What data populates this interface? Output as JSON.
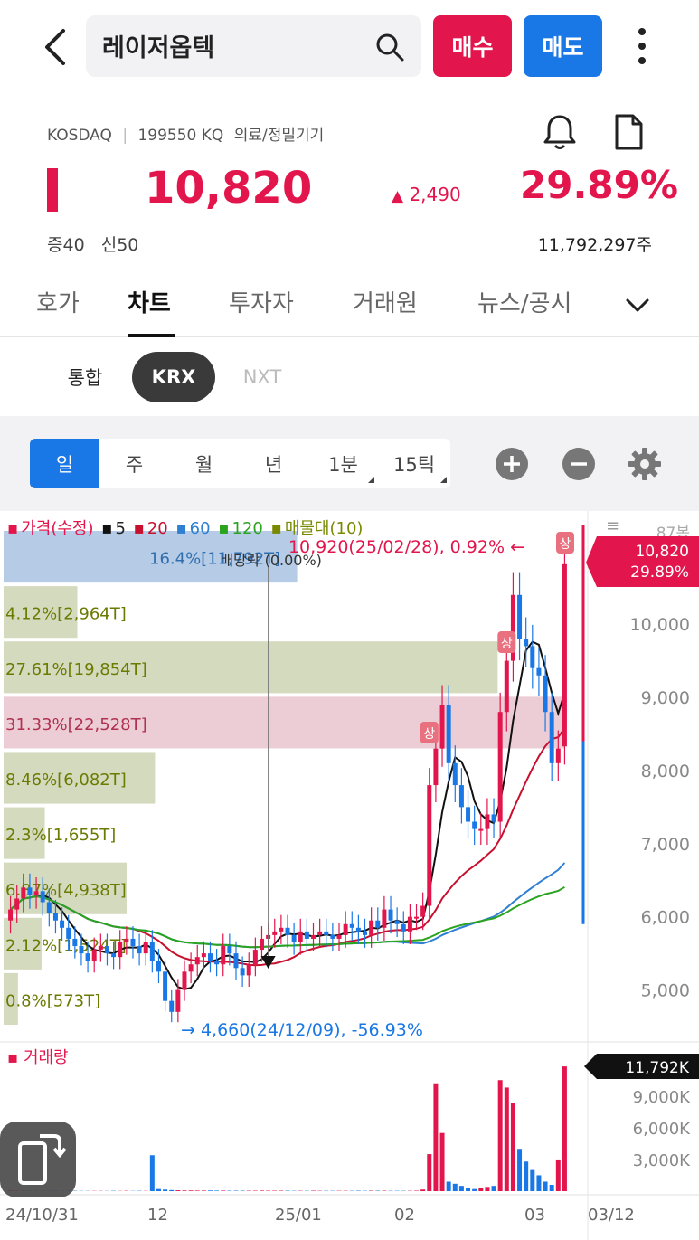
{
  "header": {
    "stock_name": "레이저옵텍",
    "buy_label": "매수",
    "sell_label": "매도"
  },
  "info": {
    "market": "KOSDAQ",
    "separator": "|",
    "code": "199550 KQ",
    "sector": "의료/정밀기기",
    "price": "10,820",
    "change": "2,490",
    "change_rate": "29.89%",
    "margin_rate": "증40",
    "credit_rate": "신50",
    "volume": "11,792,297주"
  },
  "tabs": [
    "호가",
    "차트",
    "투자자",
    "거래원",
    "뉴스/공시"
  ],
  "active_tab": "차트",
  "market_tabs": {
    "all": "통합",
    "krx": "KRX",
    "nxt": "NXT"
  },
  "periods": [
    "일",
    "주",
    "월",
    "년",
    "1분",
    "15틱"
  ],
  "legend": {
    "price": "가격(수정)",
    "ma5": "5",
    "ma20": "20",
    "ma60": "60",
    "ma120": "120",
    "volume_profile": "매물대(10)",
    "volume": "거래량"
  },
  "colors": {
    "up": "#e2164c",
    "down": "#1a78e6",
    "ma5": "#111111",
    "ma20": "#c8102e",
    "ma60": "#2f7fd3",
    "ma120": "#2aa31e",
    "profile": "#7a8a00"
  },
  "chart_data": {
    "type": "candlestick",
    "x_tick_labels": [
      "24/10/31",
      "12",
      "25/01",
      "02",
      "03",
      "03/12"
    ],
    "y_tick_labels": [
      "5,000",
      "6,000",
      "7,000",
      "8,000",
      "9,000",
      "10,000"
    ],
    "y_top_label": "87봉",
    "ylim": [
      4500,
      11300
    ],
    "current_price_label": "10,820",
    "current_rate_label": "29.89%",
    "max_annotation": "10,920(25/02/28), 0.92% ←",
    "min_annotation": "→ 4,660(24/12/09), -56.93%",
    "dividend_annotation": "배당락 (0.00%)",
    "limit_up_badge": "상",
    "volume_profile": [
      {
        "label": "16.4%[11,792T]",
        "pct": 16.4
      },
      {
        "label": "4.12%[2,964T]",
        "pct": 4.12
      },
      {
        "label": "27.61%[19,854T]",
        "pct": 27.61
      },
      {
        "label": "31.33%[22,528T]",
        "pct": 31.33
      },
      {
        "label": "8.46%[6,082T]",
        "pct": 8.46
      },
      {
        "label": "2.3%[1,655T]",
        "pct": 2.3
      },
      {
        "label": "6.87%[4,938T]",
        "pct": 6.87
      },
      {
        "label": "2.12%[1,524T]",
        "pct": 2.12
      },
      {
        "label": "0.8%[573T]",
        "pct": 0.8
      }
    ],
    "closes": [
      6100,
      6250,
      6400,
      6300,
      6350,
      6200,
      6050,
      5950,
      5850,
      5700,
      5600,
      5500,
      5400,
      5550,
      5600,
      5500,
      5450,
      5650,
      5700,
      5600,
      5500,
      5650,
      5400,
      5250,
      4850,
      4700,
      5000,
      5250,
      5350,
      5450,
      5500,
      5400,
      5350,
      5600,
      5500,
      5300,
      5200,
      5350,
      5550,
      5700,
      5750,
      5800,
      5850,
      5750,
      5650,
      5800,
      5700,
      5750,
      5800,
      5750,
      5700,
      5750,
      5900,
      5850,
      5800,
      5750,
      5950,
      5850,
      6100,
      5950,
      5900,
      5800,
      6000,
      6000,
      6150,
      7800,
      8300,
      8900,
      8100,
      7800,
      7500,
      7300,
      7200,
      7200,
      7400,
      7300,
      8800,
      9500,
      10400,
      9800,
      9700,
      9400,
      9300,
      8800,
      8100,
      8300,
      10820
    ],
    "opens": [
      5950,
      6100,
      6250,
      6400,
      6300,
      6350,
      6200,
      6050,
      5950,
      5850,
      5700,
      5600,
      5500,
      5400,
      5550,
      5600,
      5500,
      5450,
      5650,
      5700,
      5600,
      5500,
      5650,
      5400,
      5250,
      4850,
      4700,
      5000,
      5250,
      5350,
      5450,
      5500,
      5400,
      5350,
      5600,
      5500,
      5300,
      5200,
      5350,
      5550,
      5700,
      5750,
      5800,
      5850,
      5750,
      5650,
      5800,
      5700,
      5750,
      5800,
      5750,
      5700,
      5750,
      5900,
      5850,
      5800,
      5750,
      5950,
      5850,
      6100,
      5950,
      5900,
      5800,
      6000,
      6000,
      6150,
      7800,
      8300,
      8900,
      8100,
      7800,
      7500,
      7300,
      7200,
      7200,
      7400,
      7300,
      8800,
      9500,
      10400,
      9800,
      9700,
      9400,
      9300,
      8800,
      8100,
      8330
    ],
    "volumes_k": [
      40,
      30,
      30,
      30,
      20,
      20,
      20,
      30,
      20,
      20,
      30,
      20,
      20,
      20,
      20,
      20,
      30,
      20,
      30,
      20,
      30,
      20,
      3400,
      200,
      150,
      100,
      80,
      60,
      60,
      50,
      50,
      60,
      50,
      50,
      40,
      40,
      40,
      40,
      40,
      50,
      40,
      40,
      40,
      40,
      30,
      30,
      30,
      40,
      30,
      30,
      30,
      30,
      30,
      30,
      40,
      30,
      40,
      40,
      40,
      30,
      30,
      30,
      30,
      40,
      150,
      3500,
      10200,
      5500,
      900,
      700,
      500,
      300,
      200,
      300,
      400,
      500,
      10500,
      9800,
      8300,
      4000,
      2800,
      2000,
      1500,
      900,
      600,
      3000,
      11792
    ],
    "volume_ticks": [
      "3,000K",
      "6,000K",
      "9,000K"
    ],
    "volume_current_label": "11,792K"
  }
}
